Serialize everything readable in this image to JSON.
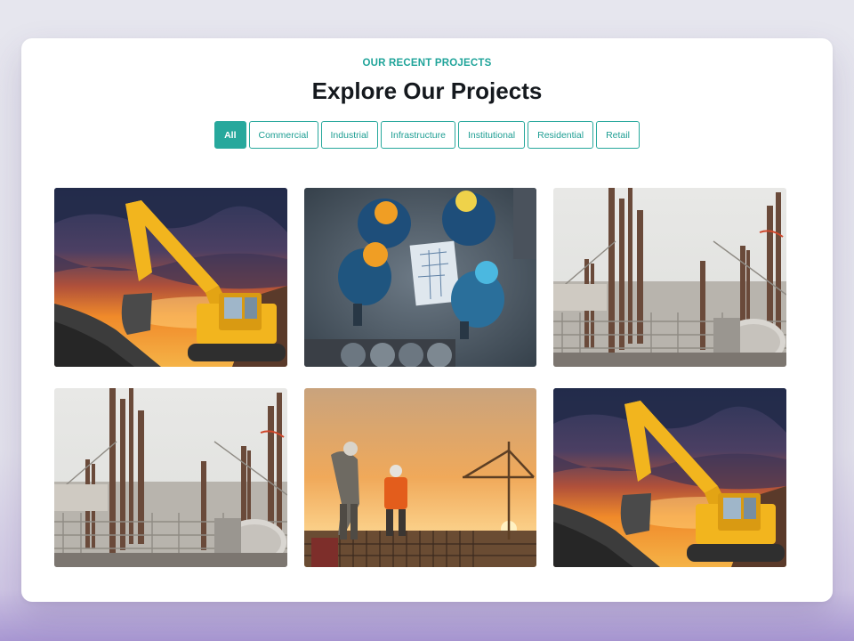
{
  "section": {
    "eyebrow": "OUR RECENT PROJECTS",
    "title": "Explore Our Projects"
  },
  "filters": [
    {
      "label": "All",
      "active": true
    },
    {
      "label": "Commercial",
      "active": false
    },
    {
      "label": "Industrial",
      "active": false
    },
    {
      "label": "Infrastructure",
      "active": false
    },
    {
      "label": "Institutional",
      "active": false
    },
    {
      "label": "Residential",
      "active": false
    },
    {
      "label": "Retail",
      "active": false
    }
  ],
  "projects": [
    {
      "image": "excavator-at-sunset"
    },
    {
      "image": "workers-reviewing-blueprints"
    },
    {
      "image": "rebar-columns-site"
    },
    {
      "image": "rebar-columns-site"
    },
    {
      "image": "engineers-at-sunset-with-crane"
    },
    {
      "image": "excavator-at-sunset"
    }
  ],
  "colors": {
    "accent": "#27a89c",
    "title": "#15191e",
    "card": "#ffffff"
  }
}
